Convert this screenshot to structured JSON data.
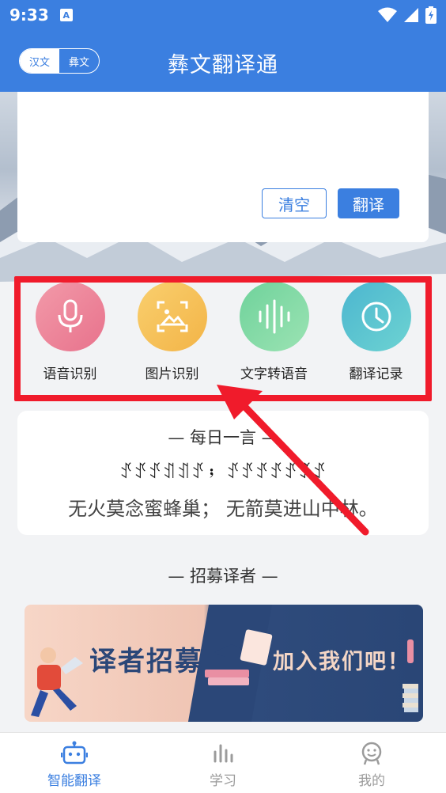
{
  "status_bar": {
    "time": "9:33",
    "notification_badge": "A"
  },
  "header": {
    "title": "彝文翻译通",
    "lang_toggle": {
      "left": "汉文",
      "right": "彝文"
    }
  },
  "input_card": {
    "clear_label": "清空",
    "translate_label": "翻译"
  },
  "features": [
    {
      "label": "语音识别",
      "icon": "microphone-icon",
      "color": "#ef8aa0"
    },
    {
      "label": "图片识别",
      "icon": "image-scan-icon",
      "color": "#f7c05a"
    },
    {
      "label": "文字转语音",
      "icon": "sound-wave-icon",
      "color": "#7fd7a3"
    },
    {
      "label": "翻译记录",
      "icon": "clock-icon",
      "color": "#52c0cc"
    }
  ],
  "daily_quote": {
    "title": "— 每日一言 —",
    "yi_text": "ꀋꀋꀋꀊꀊꀋ；  ꀋꀋꀋꀋꀋꀋꀋ",
    "zh_text": "无火莫念蜜蜂巢；  无箭莫进山中林。"
  },
  "recruit": {
    "title": "— 招募译者 —",
    "banner_left": "译者招募",
    "banner_right": "加入我们吧！"
  },
  "bottom_nav": [
    {
      "label": "智能翻译",
      "icon": "robot-icon",
      "active": true
    },
    {
      "label": "学习",
      "icon": "bar-chart-icon",
      "active": false
    },
    {
      "label": "我的",
      "icon": "user-face-icon",
      "active": false
    }
  ],
  "colors": {
    "primary": "#3b7fe0",
    "highlight": "#f01b2b"
  }
}
